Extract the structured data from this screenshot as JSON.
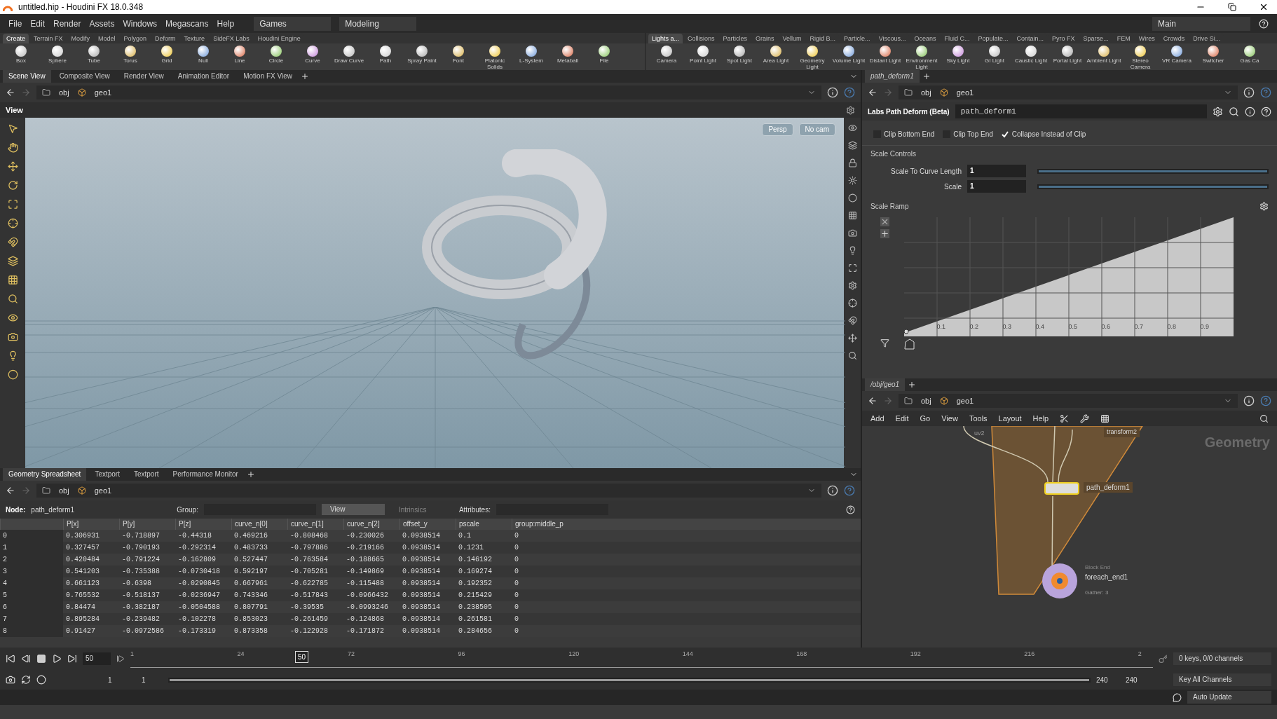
{
  "window": {
    "title": "untitled.hip - Houdini FX 18.0.348"
  },
  "menu": [
    "File",
    "Edit",
    "Render",
    "Assets",
    "Windows",
    "Megascans",
    "Help"
  ],
  "desktop": "Games",
  "context": "Modeling",
  "layout": "Main",
  "shelf_left": {
    "tabs": [
      {
        "label": "Create",
        "selected": true
      },
      {
        "label": "Terrain FX",
        "selected": false
      },
      {
        "label": "Modify",
        "selected": false
      },
      {
        "label": "Model",
        "selected": false
      },
      {
        "label": "Polygon",
        "selected": false
      },
      {
        "label": "Deform",
        "selected": false
      },
      {
        "label": "Texture",
        "selected": false
      },
      {
        "label": "SideFX Labs",
        "selected": false
      },
      {
        "label": "Houdini Engine",
        "selected": false
      }
    ],
    "tools": [
      "Box",
      "Sphere",
      "Tube",
      "Torus",
      "Grid",
      "Null",
      "Line",
      "Circle",
      "Curve",
      "Draw Curve",
      "Path",
      "Spray Paint",
      "Font",
      "Platonic Solids",
      "L-System",
      "Metaball",
      "File"
    ]
  },
  "shelf_right": {
    "tabs": [
      {
        "label": "Lights a...",
        "selected": true
      },
      {
        "label": "Collisions",
        "selected": false
      },
      {
        "label": "Particles",
        "selected": false
      },
      {
        "label": "Grains",
        "selected": false
      },
      {
        "label": "Vellum",
        "selected": false
      },
      {
        "label": "Rigid B...",
        "selected": false
      },
      {
        "label": "Particle...",
        "selected": false
      },
      {
        "label": "Viscous...",
        "selected": false
      },
      {
        "label": "Oceans",
        "selected": false
      },
      {
        "label": "Fluid C...",
        "selected": false
      },
      {
        "label": "Populate...",
        "selected": false
      },
      {
        "label": "Contain...",
        "selected": false
      },
      {
        "label": "Pyro FX",
        "selected": false
      },
      {
        "label": "Sparse...",
        "selected": false
      },
      {
        "label": "FEM",
        "selected": false
      },
      {
        "label": "Wires",
        "selected": false
      },
      {
        "label": "Crowds",
        "selected": false
      },
      {
        "label": "Drive Si...",
        "selected": false
      }
    ],
    "tools": [
      "Camera",
      "Point Light",
      "Spot Light",
      "Area Light",
      "Geometry Light",
      "Volume Light",
      "Distant Light",
      "Environment Light",
      "Sky Light",
      "GI Light",
      "Caustic Light",
      "Portal Light",
      "Ambient Light",
      "Stereo Camera",
      "VR Camera",
      "Switcher",
      "Gas Ca"
    ]
  },
  "view_tabs": [
    {
      "label": "Scene View",
      "selected": true
    },
    {
      "label": "Composite View",
      "selected": false
    },
    {
      "label": "Render View",
      "selected": false
    },
    {
      "label": "Animation Editor",
      "selected": false
    },
    {
      "label": "Motion FX View",
      "selected": false
    }
  ],
  "viewport": {
    "path": [
      "obj",
      "geo1"
    ],
    "title": "View",
    "menus": [
      "Persp",
      "No cam"
    ]
  },
  "spreadsheet": {
    "tabs": [
      {
        "label": "Geometry Spreadsheet",
        "selected": true
      },
      {
        "label": "Textport",
        "selected": false
      },
      {
        "label": "Textport",
        "selected": false
      },
      {
        "label": "Performance Monitor",
        "selected": false
      }
    ],
    "path": [
      "obj",
      "geo1"
    ],
    "node_label": "Node:",
    "node": "path_deform1",
    "group_label": "Group:",
    "view_menu": "View",
    "intrinsics": "Intrinsics",
    "attributes_label": "Attributes:",
    "columns": [
      "",
      "P[x]",
      "P[y]",
      "P[z]",
      "curve_n[0]",
      "curve_n[1]",
      "curve_n[2]",
      "offset_y",
      "pscale",
      "group:middle_p"
    ],
    "rows": [
      [
        "0",
        "0.306931",
        "-0.718897",
        "-0.44318",
        "0.469216",
        "-0.808468",
        "-0.230026",
        "0.0938514",
        "0.1",
        "0"
      ],
      [
        "1",
        "0.327457",
        "-0.790193",
        "-0.292314",
        "0.483733",
        "-0.797886",
        "-0.219166",
        "0.0938514",
        "0.1231",
        "0"
      ],
      [
        "2",
        "0.420484",
        "-0.791224",
        "-0.162809",
        "0.527447",
        "-0.763584",
        "-0.188665",
        "0.0938514",
        "0.146192",
        "0"
      ],
      [
        "3",
        "0.541203",
        "-0.735388",
        "-0.0730418",
        "0.592197",
        "-0.705281",
        "-0.149869",
        "0.0938514",
        "0.169274",
        "0"
      ],
      [
        "4",
        "0.661123",
        "-0.6398",
        "-0.0290845",
        "0.667961",
        "-0.622785",
        "-0.115488",
        "0.0938514",
        "0.192352",
        "0"
      ],
      [
        "5",
        "0.765532",
        "-0.518137",
        "-0.0236947",
        "0.743346",
        "-0.517843",
        "-0.0966432",
        "0.0938514",
        "0.215429",
        "0"
      ],
      [
        "6",
        "0.84474",
        "-0.382187",
        "-0.0504588",
        "0.807791",
        "-0.39535",
        "-0.0993246",
        "0.0938514",
        "0.238505",
        "0"
      ],
      [
        "7",
        "0.895284",
        "-0.239482",
        "-0.102278",
        "0.853023",
        "-0.261459",
        "-0.124868",
        "0.0938514",
        "0.261581",
        "0"
      ],
      [
        "8",
        "0.91427",
        "-0.0972586",
        "-0.173319",
        "0.873358",
        "-0.122928",
        "-0.171872",
        "0.0938514",
        "0.284656",
        "0"
      ]
    ]
  },
  "parameters": {
    "tab": "path_deform1",
    "path": [
      "obj",
      "geo1"
    ],
    "node_type": "Labs Path Deform (Beta)",
    "node_name": "path_deform1",
    "checkboxes": [
      {
        "label": "Clip Bottom End",
        "checked": false
      },
      {
        "label": "Clip Top End",
        "checked": false
      },
      {
        "label": "Collapse Instead of Clip",
        "checked": true
      }
    ],
    "section": "Scale Controls",
    "sliders": [
      {
        "label": "Scale To Curve Length",
        "value": "1",
        "level": 1
      },
      {
        "label": "Scale",
        "value": "1",
        "level": 1
      }
    ],
    "ramp": {
      "label": "Scale Ramp",
      "ticks": [
        "0.1",
        "0.2",
        "0.3",
        "0.4",
        "0.5",
        "0.6",
        "0.7",
        "0.8",
        "0.9"
      ]
    }
  },
  "network": {
    "tab": "/obj/geo1",
    "path": [
      "obj",
      "geo1"
    ],
    "menu": [
      "Add",
      "Edit",
      "Go",
      "View",
      "Tools",
      "Layout",
      "Help"
    ],
    "context": "Geometry",
    "nodes": [
      {
        "name": "uv2"
      },
      {
        "name": "transform2"
      },
      {
        "name": "path_deform1",
        "selected": true
      },
      {
        "name": "foreach_end1",
        "type_label": "Block End",
        "info": "Gather: 3"
      }
    ]
  },
  "timeline": {
    "frame": "50",
    "marker": "50",
    "ticks": [
      "1",
      "24",
      "72",
      "96",
      "120",
      "144",
      "168",
      "192",
      "216",
      "2"
    ],
    "start": "1",
    "start2": "1",
    "range": {
      "level": 1
    },
    "end": "240",
    "end2": "240",
    "keys": "0 keys, 0/0 channels",
    "key_all": "Key All Channels",
    "update": "Auto Update"
  }
}
